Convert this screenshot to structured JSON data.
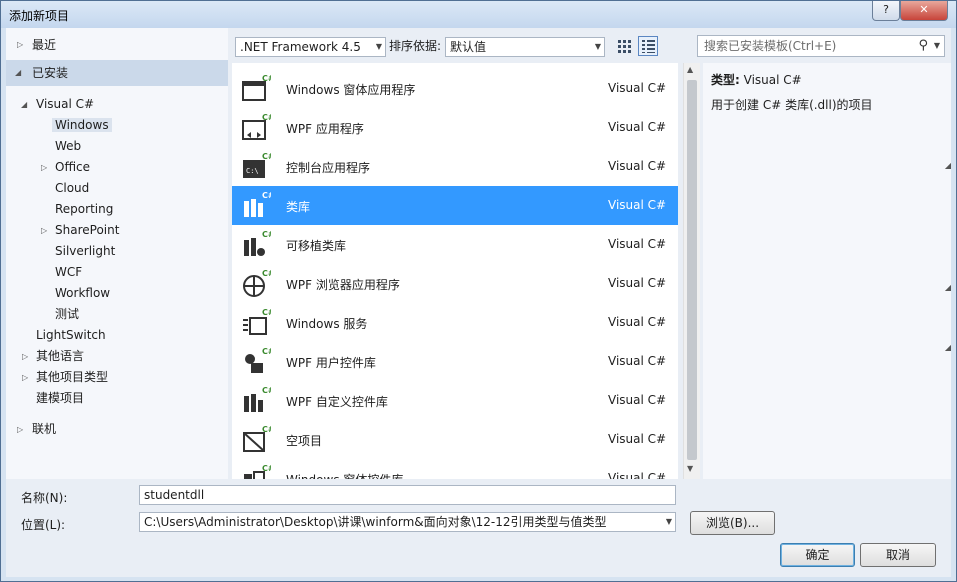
{
  "window": {
    "title": "添加新项目",
    "help": "?",
    "close": "✕"
  },
  "tree": {
    "recent": "最近",
    "installed": "已安装",
    "visual_csharp": "Visual C#",
    "children": [
      "Windows",
      "Web",
      "Office",
      "Cloud",
      "Reporting",
      "SharePoint",
      "Silverlight",
      "WCF",
      "Workflow",
      "测试"
    ],
    "lightswitch": "LightSwitch",
    "other_languages": "其他语言",
    "other_project_types": "其他项目类型",
    "modeling_projects": "建模项目",
    "online": "联机"
  },
  "toolbar": {
    "framework": ".NET Framework 4.5",
    "sort_label": "排序依据:",
    "sort_value": "默认值"
  },
  "search": {
    "placeholder": "搜索已安装模板(Ctrl+E)"
  },
  "templates": [
    {
      "name": "Windows 窗体应用程序",
      "lang": "Visual C#"
    },
    {
      "name": "WPF 应用程序",
      "lang": "Visual C#"
    },
    {
      "name": "控制台应用程序",
      "lang": "Visual C#"
    },
    {
      "name": "类库",
      "lang": "Visual C#"
    },
    {
      "name": "可移植类库",
      "lang": "Visual C#"
    },
    {
      "name": "WPF 浏览器应用程序",
      "lang": "Visual C#"
    },
    {
      "name": "Windows 服务",
      "lang": "Visual C#"
    },
    {
      "name": "WPF 用户控件库",
      "lang": "Visual C#"
    },
    {
      "name": "WPF 自定义控件库",
      "lang": "Visual C#"
    },
    {
      "name": "空项目",
      "lang": "Visual C#"
    },
    {
      "name": "Windows 窗体控件库",
      "lang": "Visual C#"
    }
  ],
  "selected_index": 3,
  "description": {
    "type_label": "类型:",
    "type_value": "Visual C#",
    "text": "用于创建 C# 类库(.dll)的项目"
  },
  "form": {
    "name_label": "名称(N):",
    "name_value": "studentdll",
    "location_label": "位置(L):",
    "location_value": "C:\\Users\\Administrator\\Desktop\\讲课\\winform&面向对象\\12-12引用类型与值类型",
    "browse": "浏览(B)...",
    "ok": "确定",
    "cancel": "取消"
  },
  "colors": {
    "selection": "#3399ff",
    "installed_header": "#cbd9ea"
  }
}
